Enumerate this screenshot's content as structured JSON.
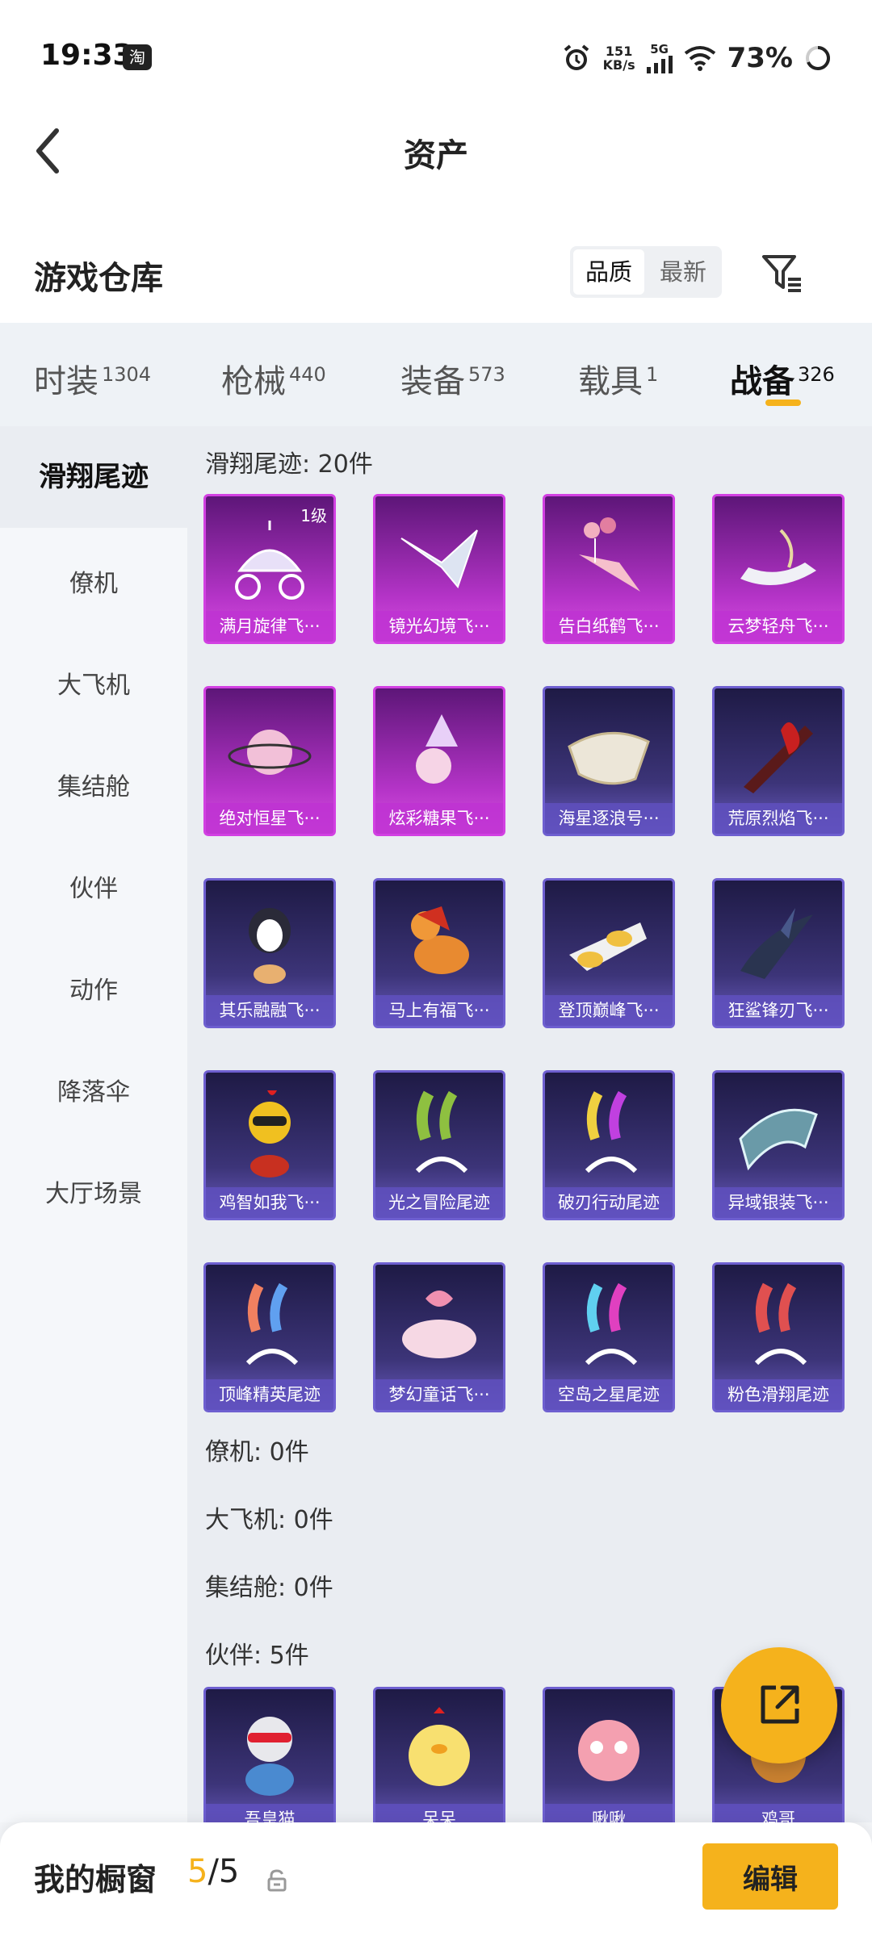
{
  "status": {
    "time": "19:33",
    "tb_icon": "淘",
    "speed_value": "151",
    "speed_unit": "KB/s",
    "network": "5G",
    "battery": "73%"
  },
  "nav": {
    "title": "资产"
  },
  "header": {
    "title": "游戏仓库",
    "sort_options": [
      "品质",
      "最新"
    ],
    "active_sort": "品质"
  },
  "tabs": [
    {
      "label": "时装",
      "count": "1304"
    },
    {
      "label": "枪械",
      "count": "440"
    },
    {
      "label": "装备",
      "count": "573"
    },
    {
      "label": "载具",
      "count": "1"
    },
    {
      "label": "战备",
      "count": "326",
      "active": true
    }
  ],
  "sidebar": {
    "items": [
      "滑翔尾迹",
      "僚机",
      "大飞机",
      "集结舱",
      "伙伴",
      "动作",
      "降落伞",
      "大厅场景"
    ],
    "active": "滑翔尾迹"
  },
  "sections": {
    "glide_trail": "滑翔尾迹: 20件",
    "wingman": "僚机: 0件",
    "plane": "大飞机: 0件",
    "pod": "集结舱: 0件",
    "partner": "伙伴: 5件"
  },
  "items": [
    {
      "name": "满月旋律飞···",
      "level": "1级",
      "rarity": "purple",
      "icon": "carriage-icon"
    },
    {
      "name": "镜光幻境飞···",
      "rarity": "purple",
      "icon": "crystal-wing-icon"
    },
    {
      "name": "告白纸鹤飞···",
      "rarity": "purple",
      "icon": "paper-crane-icon"
    },
    {
      "name": "云梦轻舟飞···",
      "rarity": "purple",
      "icon": "cloud-boat-icon"
    },
    {
      "name": "绝对恒星飞···",
      "rarity": "purple",
      "icon": "planet-icon"
    },
    {
      "name": "炫彩糖果飞···",
      "rarity": "purple",
      "icon": "candy-icon"
    },
    {
      "name": "海星逐浪号···",
      "rarity": "blue",
      "icon": "boat-icon"
    },
    {
      "name": "荒原烈焰飞···",
      "rarity": "blue",
      "icon": "flame-glider-icon"
    },
    {
      "name": "其乐融融飞···",
      "rarity": "blue",
      "icon": "penguin-icon"
    },
    {
      "name": "马上有福飞···",
      "rarity": "blue",
      "icon": "horse-icon"
    },
    {
      "name": "登顶巅峰飞···",
      "rarity": "blue",
      "icon": "jet-icon"
    },
    {
      "name": "狂鲨锋刃飞···",
      "rarity": "blue",
      "icon": "shark-icon"
    },
    {
      "name": "鸡智如我飞···",
      "rarity": "blue",
      "icon": "chicken-icon"
    },
    {
      "name": "光之冒险尾迹",
      "rarity": "blue",
      "icon": "trail-green-icon"
    },
    {
      "name": "破刃行动尾迹",
      "rarity": "blue",
      "icon": "trail-rainbow-icon"
    },
    {
      "name": "异域银装飞···",
      "rarity": "blue",
      "icon": "silver-wing-icon"
    },
    {
      "name": "顶峰精英尾迹",
      "rarity": "blue",
      "icon": "trail-blue-icon"
    },
    {
      "name": "梦幻童话飞···",
      "rarity": "blue",
      "icon": "fairy-bed-icon"
    },
    {
      "name": "空岛之星尾迹",
      "rarity": "blue",
      "icon": "trail-purple-icon"
    },
    {
      "name": "粉色滑翔尾迹",
      "rarity": "blue",
      "icon": "trail-pink-icon"
    }
  ],
  "partners": [
    {
      "name": "吾皇猫",
      "rarity": "blue",
      "icon": "cat-icon"
    },
    {
      "name": "呆呆",
      "rarity": "blue",
      "icon": "chick-icon"
    },
    {
      "name": "啾啾",
      "rarity": "blue",
      "icon": "pink-bird-icon"
    },
    {
      "name": "鸡哥",
      "rarity": "blue",
      "icon": "rooster-icon"
    }
  ],
  "bottom": {
    "label": "我的橱窗",
    "current": "5",
    "total": "/5",
    "edit_label": "编辑"
  },
  "colors": {
    "accent": "#f5b21c",
    "purple": "#d240e2",
    "blue": "#6e5fd0"
  }
}
